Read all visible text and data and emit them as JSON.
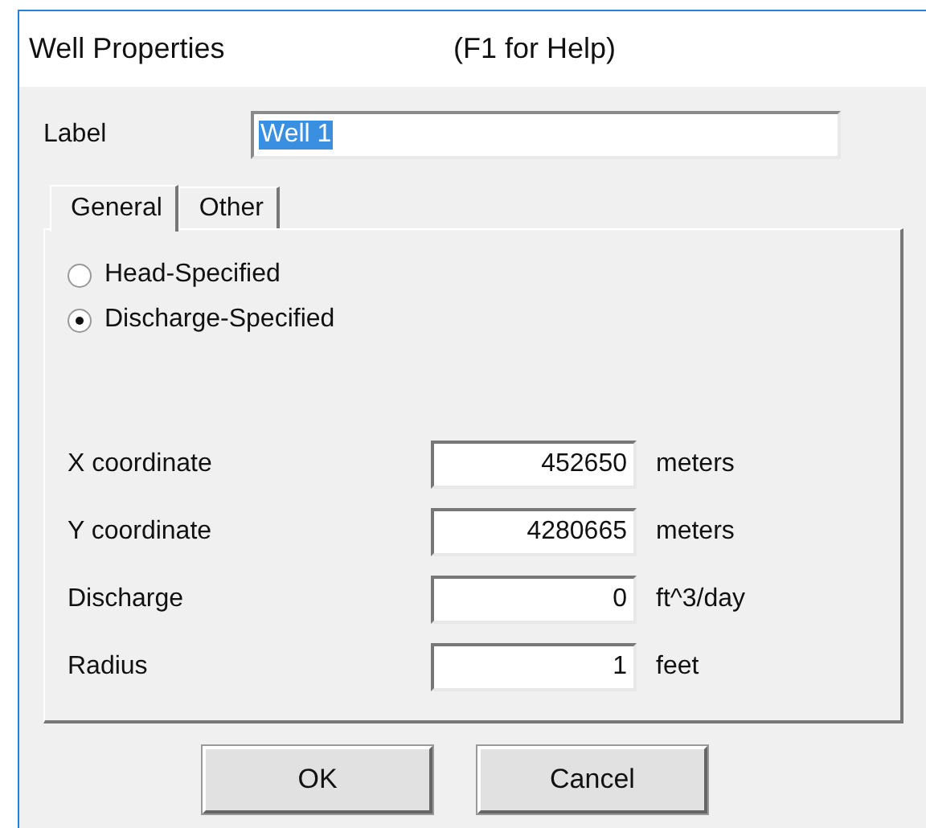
{
  "window": {
    "title": "Well Properties",
    "help_hint": "(F1 for Help)"
  },
  "label_field": {
    "label": "Label",
    "value": "Well 1",
    "text_selected": true
  },
  "tabs": [
    {
      "label": "General",
      "selected": true
    },
    {
      "label": "Other",
      "selected": false
    }
  ],
  "radios": [
    {
      "label": "Head-Specified",
      "selected": false
    },
    {
      "label": "Discharge-Specified",
      "selected": true
    }
  ],
  "fields": [
    {
      "label": "X coordinate",
      "value": "452650",
      "unit": "meters"
    },
    {
      "label": "Y coordinate",
      "value": "4280665",
      "unit": "meters"
    },
    {
      "label": "Discharge",
      "value": "0",
      "unit": "ft^3/day"
    },
    {
      "label": "Radius",
      "value": "1",
      "unit": "feet"
    }
  ],
  "buttons": [
    "OK",
    "Cancel"
  ]
}
